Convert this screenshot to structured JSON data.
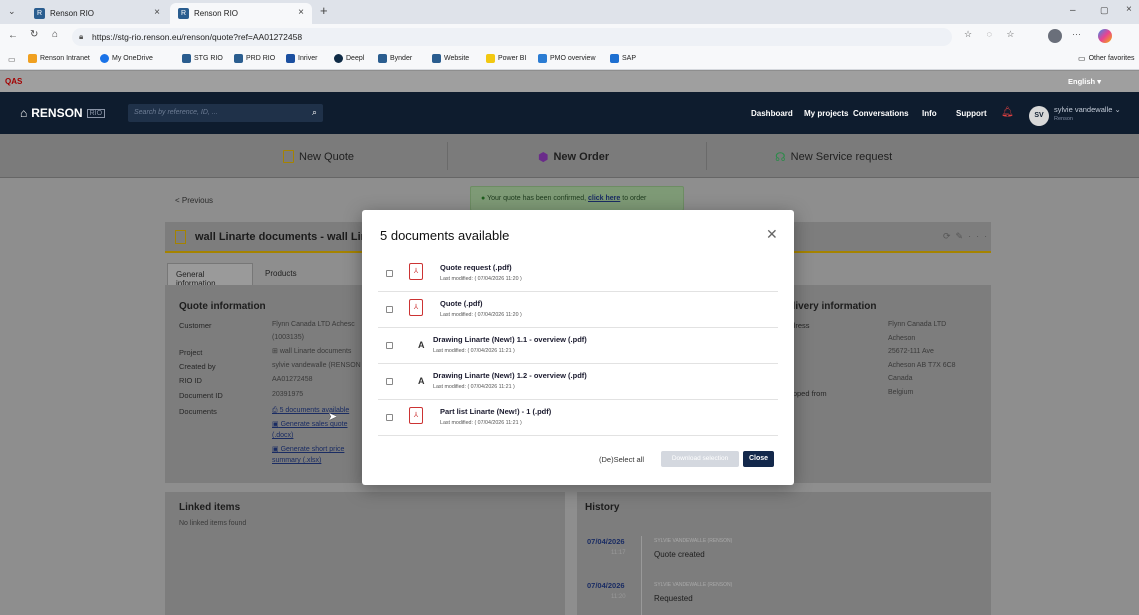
{
  "browser": {
    "tabs": [
      {
        "label": "Renson RIO"
      },
      {
        "label": "Renson RIO"
      }
    ],
    "url": "https://stg-rio.renson.eu/renson/quote?ref=AA01272458",
    "bookmarks": [
      "Renson Intranet",
      "My OneDrive",
      "STG RIO",
      "PRD RIO",
      "Inriver",
      "Deepl",
      "Bynder",
      "Website",
      "Power BI",
      "PMO overview",
      "SAP"
    ],
    "other_favorites": "Other favorites"
  },
  "env": {
    "label": "QAS",
    "language": "English"
  },
  "nav": {
    "logo": "RENSON",
    "logo_tag": "RIO",
    "search_placeholder": "Search by reference, ID, ...",
    "links": [
      "Dashboard",
      "My projects",
      "Conversations",
      "Info",
      "Support"
    ],
    "user_initials": "SV",
    "user_name": "sylvie vandewalle",
    "user_company": "Renson"
  },
  "actions": {
    "new_quote": "New Quote",
    "new_order": "New Order",
    "new_service": "New Service request"
  },
  "previous": "< Previous",
  "toast": {
    "text": "Your quote has been confirmed, ",
    "link": "click here",
    "suffix": " to order"
  },
  "quote_title": "wall Linarte documents - wall Lir",
  "page_tabs": [
    "General information",
    "Products"
  ],
  "quote_info": {
    "heading": "Quote information",
    "rows": [
      {
        "label": "Customer",
        "value": "Flynn Canada LTD Achesc"
      },
      {
        "label": "",
        "value": "(1003135)"
      },
      {
        "label": "Project",
        "value": "wall Linarte documents"
      },
      {
        "label": "Created by",
        "value": "sylvie vandewalle (RENSON"
      },
      {
        "label": "RIO ID",
        "value": "AA01272458"
      },
      {
        "label": "Document ID",
        "value": "20391975"
      },
      {
        "label": "Documents",
        "value": "5 documents available"
      }
    ],
    "doc_links": [
      "Generate sales quote",
      "(.docx)",
      "Generate short price",
      "summary (.xlsx)"
    ]
  },
  "delivery": {
    "heading": "elivery information",
    "address_label": "ddress",
    "address": [
      "Flynn Canada LTD",
      "Acheson",
      "25672-111 Ave",
      "Acheson AB T7X 6C8",
      "Canada"
    ],
    "shipped_label": "hipped from",
    "shipped_value": "Belgium"
  },
  "linked": {
    "heading": "Linked items",
    "empty": "No linked items found"
  },
  "history": {
    "heading": "History",
    "entries": [
      {
        "date": "07/04/2026",
        "time": "11:17",
        "by": "SYLVIE VANDEWALLE (RENSON)",
        "event": "Quote created"
      },
      {
        "date": "07/04/2026",
        "time": "11:20",
        "by": "SYLVIE VANDEWALLE (RENSON)",
        "event": "Requested"
      }
    ]
  },
  "modal": {
    "title": "5 documents available",
    "documents": [
      {
        "name": "Quote request (.pdf)",
        "modified": "Last modified: ( 07/04/2026 11:20 )",
        "icon": "pdf-icon"
      },
      {
        "name": "Quote (.pdf)",
        "modified": "Last modified: ( 07/04/2026 11:20 )",
        "icon": "pdf-icon"
      },
      {
        "name": "Drawing Linarte (New!) 1.1 - overview (.pdf)",
        "modified": "Last modified: ( 07/04/2026 11:21 )",
        "icon": "drawing-icon"
      },
      {
        "name": "Drawing Linarte (New!) 1.2 - overview (.pdf)",
        "modified": "Last modified: ( 07/04/2026 11:21 )",
        "icon": "drawing-icon"
      },
      {
        "name": "Part list Linarte (New!) - 1 (.pdf)",
        "modified": "Last modified: ( 07/04/2026 11:21 )",
        "icon": "pdf-icon"
      }
    ],
    "deselect_all": "(De)Select all",
    "download": "Download selection",
    "close": "Close"
  },
  "colors": {
    "navbar": "#0e1c2e",
    "accent": "#a58300",
    "primary_button": "#13284b"
  }
}
